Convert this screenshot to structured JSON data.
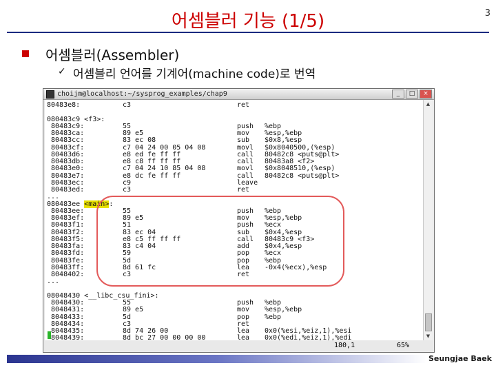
{
  "slide": {
    "title": "어셈블러 기능 (1/5)",
    "page_number": "3",
    "bullet1": "어셈블러(Assembler)",
    "bullet2_check": "✓",
    "bullet2": "어셈블리 언어를 기계어(machine code)로 번역",
    "footer": "Seungjae Baek",
    "accent_color": "#cc0000"
  },
  "terminal": {
    "title": "choijm@localhost:~/sysprog_examples/chap9",
    "buttons": {
      "minimize": "_",
      "maximize": "□",
      "close": "×"
    },
    "status_pos": "180,1",
    "status_pct": "65%",
    "lines": [
      {
        "addr": "80483e8:",
        "bytes": "c3",
        "mnem": "ret",
        "ops": ""
      },
      {
        "addr": "",
        "bytes": "",
        "mnem": "",
        "ops": ""
      },
      {
        "addr": "080483c9 <f3>:",
        "bytes": "",
        "mnem": "",
        "ops": ""
      },
      {
        "addr": " 80483c9:",
        "bytes": "55",
        "mnem": "push",
        "ops": "%ebp"
      },
      {
        "addr": " 80483ca:",
        "bytes": "89 e5",
        "mnem": "mov",
        "ops": "%esp,%ebp"
      },
      {
        "addr": " 80483cc:",
        "bytes": "83 ec 08",
        "mnem": "sub",
        "ops": "$0x8,%esp"
      },
      {
        "addr": " 80483cf:",
        "bytes": "c7 04 24 00 05 04 08",
        "mnem": "movl",
        "ops": "$0x8040500,(%esp)"
      },
      {
        "addr": " 80483d6:",
        "bytes": "e8 ed fe ff ff",
        "mnem": "call",
        "ops": "80482c8 <puts@plt>"
      },
      {
        "addr": " 80483db:",
        "bytes": "e8 c8 ff ff ff",
        "mnem": "call",
        "ops": "80483a8 <f2>"
      },
      {
        "addr": " 80483e0:",
        "bytes": "c7 04 24 10 85 04 08",
        "mnem": "movl",
        "ops": "$0x8048510,(%esp)"
      },
      {
        "addr": " 80483e7:",
        "bytes": "e8 dc fe ff ff",
        "mnem": "call",
        "ops": "80482c8 <puts@plt>"
      },
      {
        "addr": " 80483ec:",
        "bytes": "c9",
        "mnem": "leave",
        "ops": ""
      },
      {
        "addr": " 80483ed:",
        "bytes": "c3",
        "mnem": "ret",
        "ops": ""
      },
      {
        "addr": "...",
        "bytes": "",
        "mnem": "",
        "ops": ""
      },
      {
        "addr": "080483ee <main>:",
        "bytes": "",
        "mnem": "",
        "ops": ""
      },
      {
        "addr": " 80483ee:",
        "bytes": "55",
        "mnem": "push",
        "ops": "%ebp"
      },
      {
        "addr": " 80483ef:",
        "bytes": "89 e5",
        "mnem": "mov",
        "ops": "%esp,%ebp"
      },
      {
        "addr": " 80483f1:",
        "bytes": "51",
        "mnem": "push",
        "ops": "%ecx"
      },
      {
        "addr": " 80483f2:",
        "bytes": "83 ec 04",
        "mnem": "sub",
        "ops": "$0x4,%esp"
      },
      {
        "addr": " 80483f5:",
        "bytes": "e8 c5 ff ff ff",
        "mnem": "call",
        "ops": "80483c9 <f3>"
      },
      {
        "addr": " 80483fa:",
        "bytes": "83 c4 04",
        "mnem": "add",
        "ops": "$0x4,%esp"
      },
      {
        "addr": " 80483fd:",
        "bytes": "59",
        "mnem": "pop",
        "ops": "%ecx"
      },
      {
        "addr": " 80483fe:",
        "bytes": "5d",
        "mnem": "pop",
        "ops": "%ebp"
      },
      {
        "addr": " 80483ff:",
        "bytes": "8d 61 fc",
        "mnem": "lea",
        "ops": "-0x4(%ecx),%esp"
      },
      {
        "addr": " 8048402:",
        "bytes": "c3",
        "mnem": "ret",
        "ops": ""
      },
      {
        "addr": "...",
        "bytes": "",
        "mnem": "",
        "ops": ""
      },
      {
        "addr": "",
        "bytes": "",
        "mnem": "",
        "ops": ""
      },
      {
        "addr": "08048430 <__libc_csu_fini>:",
        "bytes": "",
        "mnem": "",
        "ops": ""
      },
      {
        "addr": " 8048430:",
        "bytes": "55",
        "mnem": "push",
        "ops": "%ebp"
      },
      {
        "addr": " 8048431:",
        "bytes": "89 e5",
        "mnem": "mov",
        "ops": "%esp,%ebp"
      },
      {
        "addr": " 8048433:",
        "bytes": "5d",
        "mnem": "pop",
        "ops": "%ebp"
      },
      {
        "addr": " 8048434:",
        "bytes": "c3",
        "mnem": "ret",
        "ops": ""
      },
      {
        "addr": " 8048435:",
        "bytes": "8d 74 26 00",
        "mnem": "lea",
        "ops": "0x0(%esi,%eiz,1),%esi"
      },
      {
        "addr": " 8048439:",
        "bytes": "8d bc 27 00 00 00 00",
        "mnem": "lea",
        "ops": "0x0(%edi,%eiz,1),%edi"
      }
    ]
  }
}
